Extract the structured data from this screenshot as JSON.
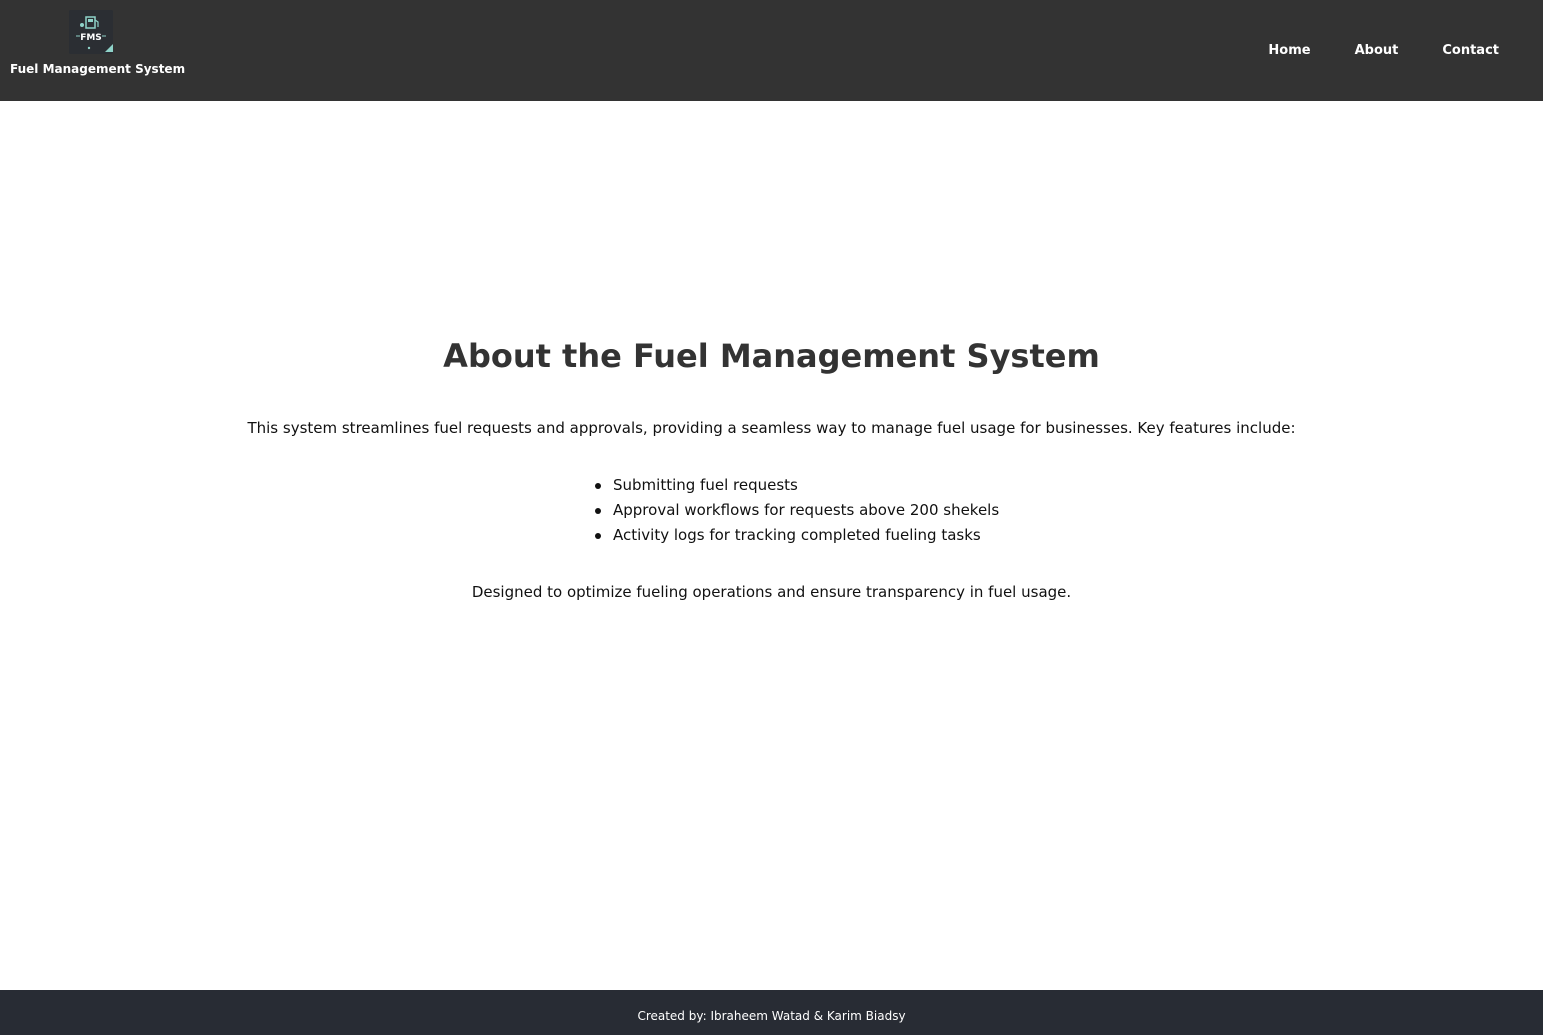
{
  "header": {
    "logo_text": "FMS",
    "brand_name": "Fuel Management System",
    "nav": [
      {
        "label": "Home"
      },
      {
        "label": "About"
      },
      {
        "label": "Contact"
      }
    ]
  },
  "main": {
    "title": "About the Fuel Management System",
    "intro": "This system streamlines fuel requests and approvals, providing a seamless way to manage fuel usage for businesses. Key features include:",
    "features": [
      "Submitting fuel requests",
      "Approval workflows for requests above 200 shekels",
      "Activity logs for tracking completed fueling tasks"
    ],
    "outro": "Designed to optimize fueling operations and ensure transparency in fuel usage."
  },
  "footer": {
    "credit": "Created by: Ibraheem Watad & Karim Biadsy"
  },
  "colors": {
    "header_bg": "#333333",
    "footer_bg": "#282c34",
    "logo_accent": "#8fd3c9"
  }
}
